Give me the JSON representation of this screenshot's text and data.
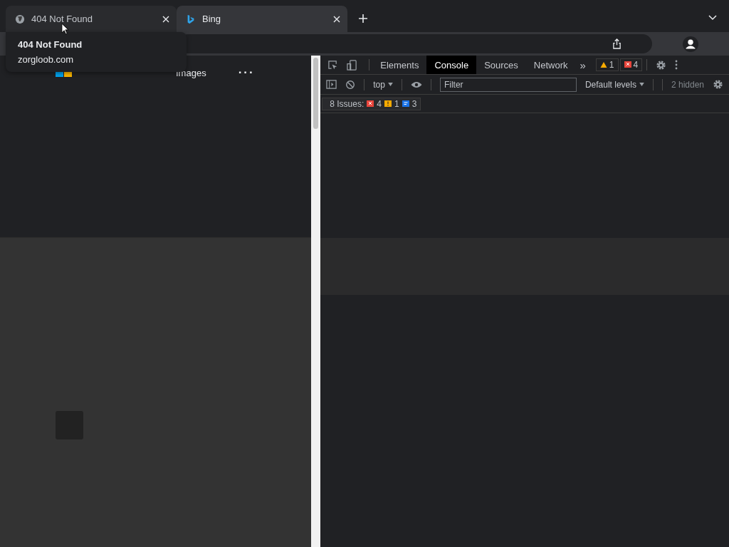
{
  "tabs": [
    {
      "title": "404 Not Found",
      "selected": false,
      "kind": "globe"
    },
    {
      "title": "Bing",
      "selected": true,
      "kind": "bing"
    }
  ],
  "tooltip": {
    "title": "404 Not Found",
    "url": "zorgloob.com"
  },
  "page": {
    "nav": [
      "Images",
      "···"
    ]
  },
  "devtools": {
    "tabs": [
      {
        "label": "Elements",
        "selected": false
      },
      {
        "label": "Console",
        "selected": true
      },
      {
        "label": "Sources",
        "selected": false
      },
      {
        "label": "Network",
        "selected": false
      }
    ],
    "more": "»",
    "warnings": "1",
    "errors": "4",
    "context": "top",
    "filter_placeholder": "Filter",
    "levels": "Default levels",
    "hidden": "2 hidden",
    "issues": {
      "label": "8 Issues:",
      "errors": "4",
      "warnings": "1",
      "info": "3"
    }
  }
}
